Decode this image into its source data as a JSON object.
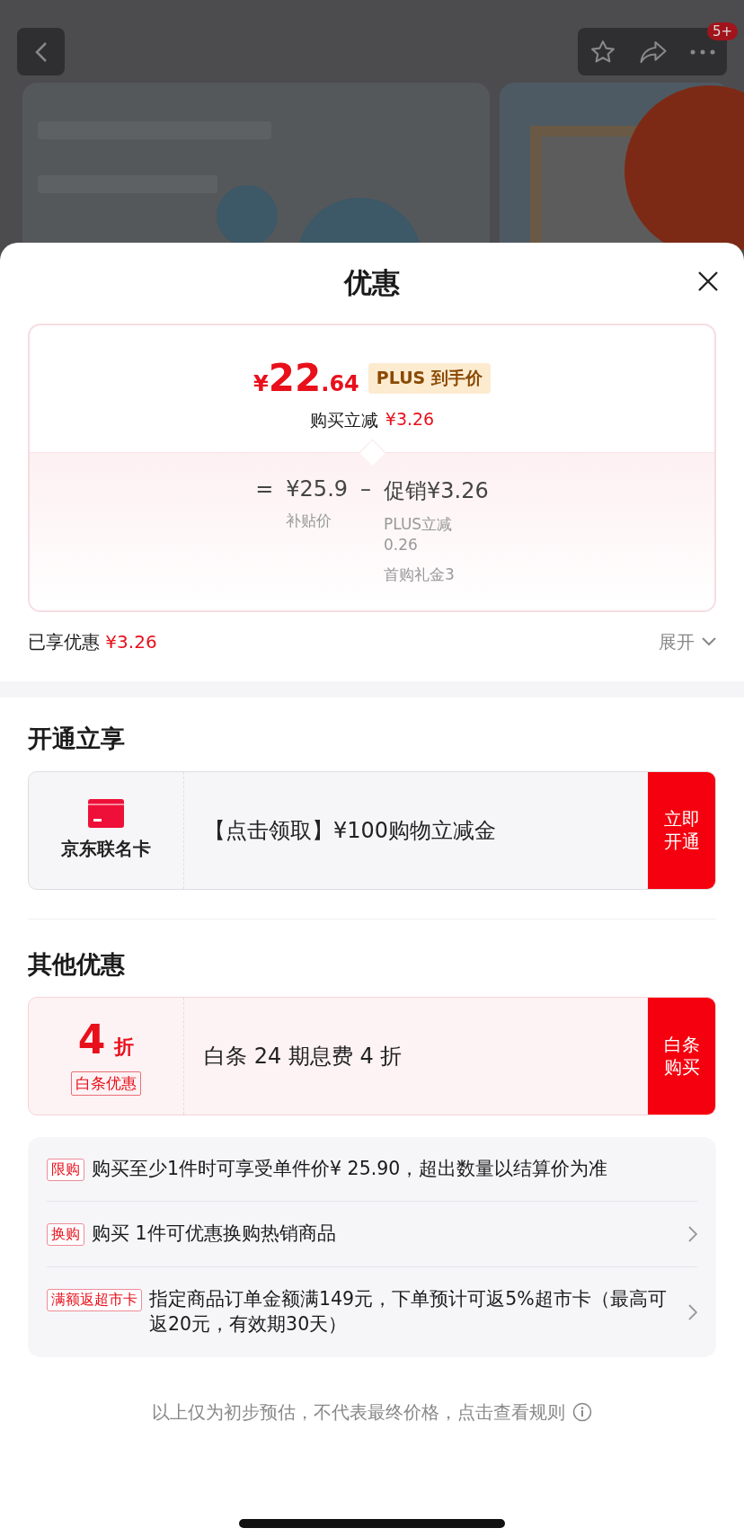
{
  "nav": {
    "badge": "5+"
  },
  "sheet": {
    "title": "优惠"
  },
  "price_card": {
    "currency": "¥",
    "integer": "22",
    "decimal": ".64",
    "tag": "PLUS 到手价",
    "reduction_label": "购买立减",
    "reduction_value": "¥3.26",
    "formula": {
      "equals": "=",
      "base": "¥25.9",
      "base_label": "补贴价",
      "minus": "–",
      "promo": "促销¥3.26",
      "promo_details": [
        "PLUS立减0.26",
        "首购礼金3"
      ]
    }
  },
  "enjoyed": {
    "label": "已享优惠",
    "value": "¥3.26",
    "toggle": "展开",
    "expanded": false
  },
  "sections": [
    {
      "title": "开通立享",
      "offer": {
        "kind": "card",
        "name": "京东联名卡",
        "text": "【点击领取】¥100购物立减金",
        "button": "立即开通"
      }
    },
    {
      "title": "其他优惠",
      "offer": {
        "kind": "discount",
        "value": "4",
        "unit": "折",
        "tag": "白条优惠",
        "text": "白条 24 期息费 4 折",
        "button": "白条购买"
      }
    }
  ],
  "promos": [
    {
      "tag": "限购",
      "text": "购买至少1件时可享受单件价¥ 25.90，超出数量以结算价为准",
      "arrow": false
    },
    {
      "tag": "换购",
      "text": "购买 1件可优惠换购热销商品",
      "arrow": true
    },
    {
      "tag": "满额返超市卡",
      "text": "指定商品订单金额满149元，下单预计可返5%超市卡（最高可返20元，有效期30天）",
      "arrow": true
    }
  ],
  "footer": "以上仅为初步预估，不代表最终价格，点击查看规则"
}
